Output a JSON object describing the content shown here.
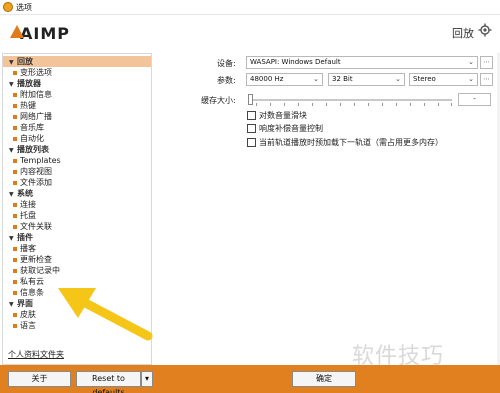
{
  "window": {
    "title": "选项"
  },
  "header": {
    "logo": "AIMP",
    "section_title": "回放"
  },
  "sidebar": {
    "categories": [
      {
        "label": "回放",
        "items": [
          "变形选项"
        ]
      },
      {
        "label": "播放器",
        "items": [
          "附加信息",
          "热键",
          "网络广播",
          "音乐库",
          "自动化"
        ]
      },
      {
        "label": "播放列表",
        "items": [
          "Templates",
          "内容视图",
          "文件添加"
        ]
      },
      {
        "label": "系统",
        "items": [
          "连接",
          "托盘",
          "文件关联"
        ]
      },
      {
        "label": "插件",
        "items": [
          "播客",
          "更新检查",
          "获取记录中",
          "私有云",
          "信息条"
        ]
      },
      {
        "label": "界面",
        "items": [
          "皮肤",
          "语言"
        ]
      }
    ],
    "profile_link": "个人资料文件夹"
  },
  "settings": {
    "device_label": "设备:",
    "device_value": "WASAPI: Windows Default",
    "params_label": "参数:",
    "sample_rate": "48000 Hz",
    "bit_depth": "32 Bit",
    "channels": "Stereo",
    "buffer_label": "缓存大小:",
    "buffer_value": "-",
    "options": [
      {
        "label": "对数音量滑块",
        "checked": false
      },
      {
        "label": "响度补偿音量控制",
        "checked": false
      },
      {
        "label": "当前轨道播放时预加载下一轨道（需占用更多内存）",
        "checked": false
      }
    ]
  },
  "footer": {
    "about_button": "关于",
    "reset_button": "Reset to defaults",
    "ok_button": "确定"
  },
  "watermark": "软件技巧",
  "colors": {
    "accent": "#e0801f",
    "selected": "#f3c49a",
    "arrow": "#f5c518"
  }
}
